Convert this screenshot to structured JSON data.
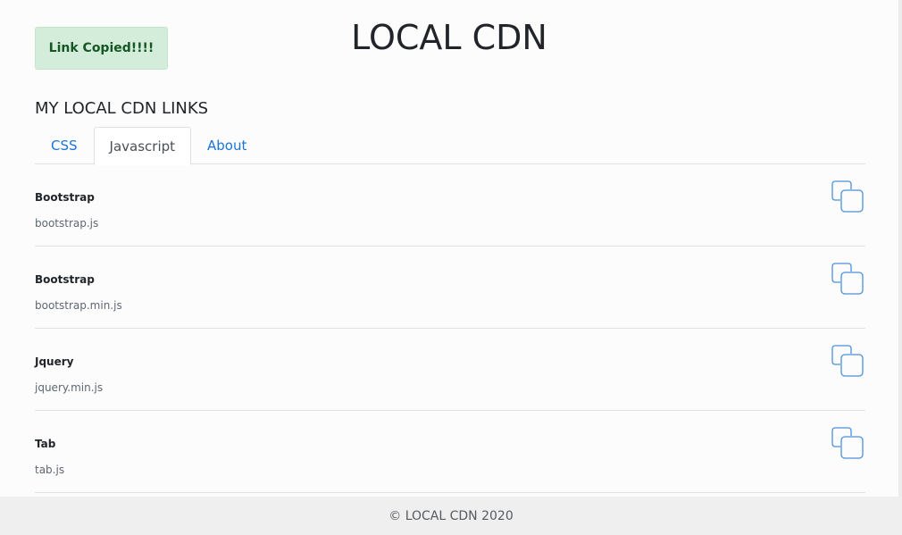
{
  "toast": {
    "text": "Link Copied!!!!"
  },
  "header": {
    "title": "LOCAL CDN"
  },
  "section": {
    "title": "MY LOCAL CDN LINKS"
  },
  "tabs": [
    {
      "label": "CSS",
      "active": false
    },
    {
      "label": "Javascript",
      "active": true
    },
    {
      "label": "About",
      "active": false
    }
  ],
  "items": [
    {
      "name": "Bootstrap",
      "file": "bootstrap.js",
      "icon": "copy-icon"
    },
    {
      "name": "Bootstrap",
      "file": "bootstrap.min.js",
      "icon": "copy-icon"
    },
    {
      "name": "Jquery",
      "file": "jquery.min.js",
      "icon": "copy-icon"
    },
    {
      "name": "Tab",
      "file": "tab.js",
      "icon": "copy-icon"
    }
  ],
  "footer": {
    "text": "© LOCAL CDN 2020"
  },
  "colors": {
    "toast_bg": "#d4edda",
    "toast_text": "#155724",
    "link": "#1a73d9",
    "icon": "#4a90d9"
  }
}
